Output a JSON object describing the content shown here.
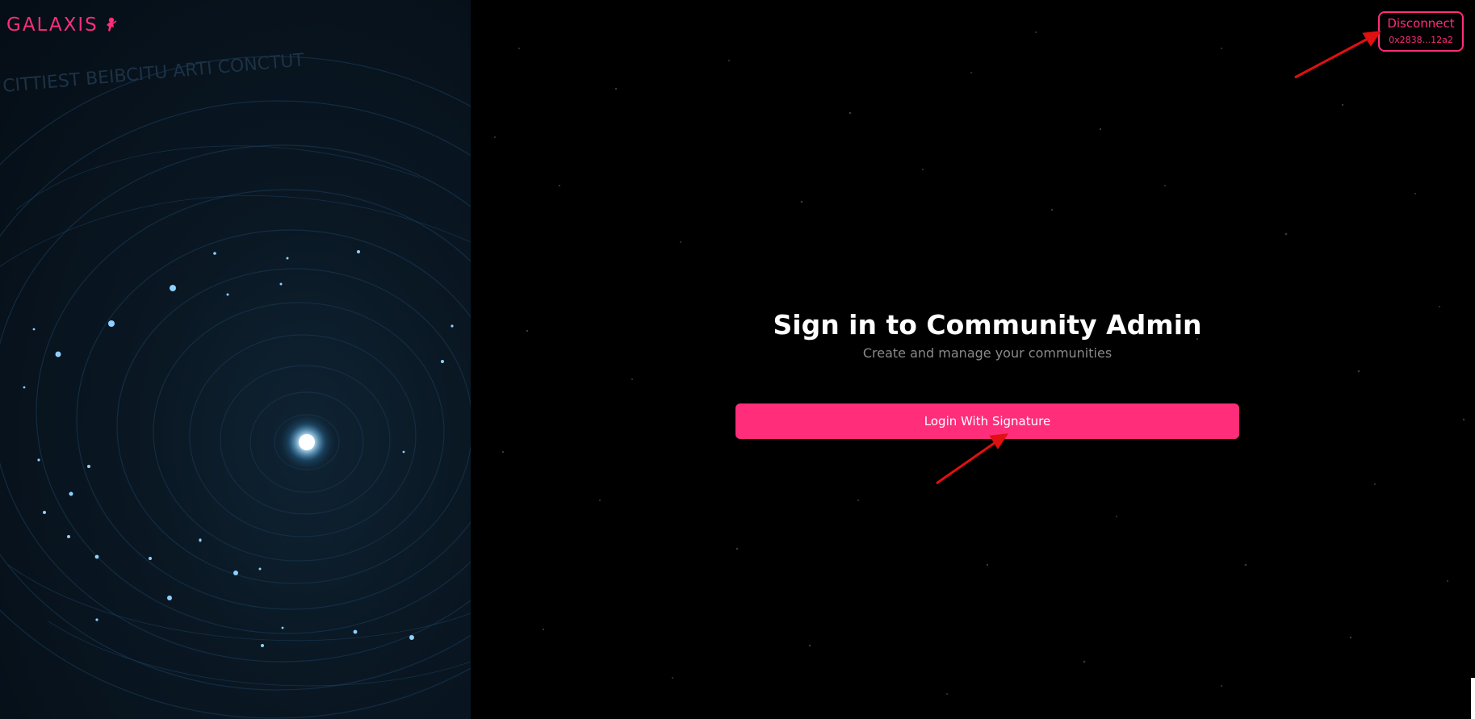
{
  "brand": {
    "name": "GALAXIS",
    "color": "#ff2d7a",
    "icon": "astronaut-icon"
  },
  "header": {
    "disconnect_label": "Disconnect",
    "wallet_address": "0x2838...12a2"
  },
  "signin": {
    "title": "Sign in to Community Admin",
    "subtitle": "Create and manage your communities",
    "login_button": "Login With Signature"
  },
  "colors": {
    "accent": "#ff2d7a",
    "background": "#000000",
    "panel": "#07121c",
    "annotation_arrow": "#e01010"
  },
  "artwork": {
    "faint_text": "CITTIEST BEIBCITU ARTI CONCTUT"
  }
}
